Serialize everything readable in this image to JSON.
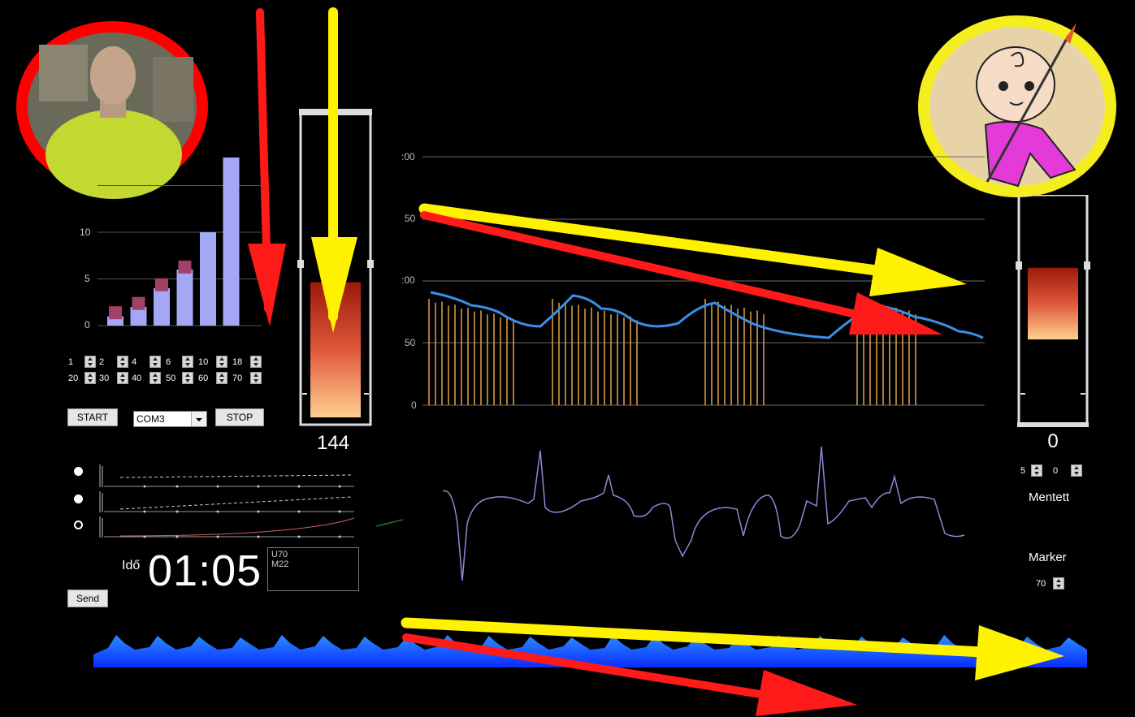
{
  "spinners_left": [
    {
      "label": "1"
    },
    {
      "label": "2"
    },
    {
      "label": "4"
    },
    {
      "label": "6"
    },
    {
      "label": "10"
    },
    {
      "label": "18"
    },
    {
      "label": "20"
    },
    {
      "label": "30"
    },
    {
      "label": "40"
    },
    {
      "label": "50"
    },
    {
      "label": "60"
    },
    {
      "label": "70"
    }
  ],
  "controls": {
    "start_label": "START",
    "stop_label": "STOP",
    "com_port": "COM3",
    "send_label": "Send"
  },
  "gauge_left": {
    "value": "144",
    "level": 0.52
  },
  "gauge_right": {
    "value": "0",
    "level": 0.45
  },
  "right_panel": {
    "spin_a": "5",
    "spin_b": "0",
    "mentett_label": "Mentett",
    "marker_label": "Marker",
    "marker_value": "70"
  },
  "timer": {
    "label": "Idő",
    "value": "01:05"
  },
  "log_box": {
    "line1": "U70",
    "line2": "M22"
  },
  "bar_chart": {
    "y_ticks": [
      "0",
      "5",
      "10"
    ],
    "values": [
      1,
      2,
      4,
      6,
      10,
      18
    ],
    "markers": [
      1.2,
      2.2,
      4.2,
      6.1
    ]
  },
  "main_chart": {
    "y_ticks": [
      "0",
      "50",
      ":00",
      "50",
      ":00"
    ],
    "colors": {
      "line": "#3a8fe8",
      "bars": "#e2a24a",
      "grid": "#6a6a6a"
    }
  },
  "colors": {
    "arrow_red": "#ff1a1a",
    "arrow_yellow": "#fff200",
    "terrain": "#1a55ff",
    "ecg": "#8a8ad8"
  },
  "icons": {
    "left_avatar": "man-photo",
    "right_avatar": "baby-cartoon-icon"
  }
}
